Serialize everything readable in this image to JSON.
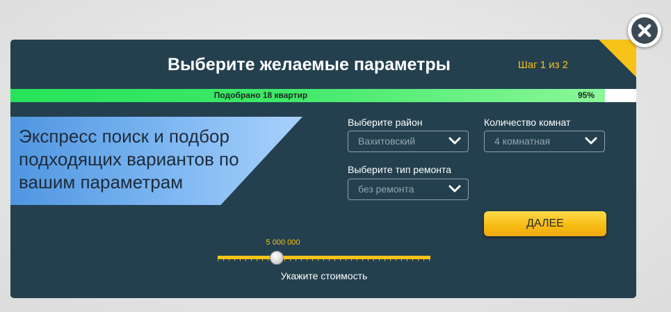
{
  "header": {
    "title": "Выберите желаемые параметры",
    "step": "Шаг 1 из 2"
  },
  "progress": {
    "text": "Подобрано 18 квартир",
    "percent_label": "95%",
    "value_percent": 95
  },
  "banner": {
    "text": "Экспресс поиск и подбор подходящих вариантов по вашим параметрам"
  },
  "filters": {
    "district_label": "Выберите район",
    "district_value": "Вахитовский",
    "rooms_label": "Количество комнат",
    "rooms_value": "4 комнатная",
    "repair_label": "Выберите тип ремонта",
    "repair_value": "без ремонта"
  },
  "next_button": {
    "label": "ДАЛЕЕ"
  },
  "price_slider": {
    "value_label": "5 000 000",
    "caption": "Укажите стоимость"
  },
  "icons": {
    "close": "close-icon",
    "chevron": "chevron-down-icon"
  },
  "colors": {
    "accent_yellow": "#f7c318",
    "modal_bg": "#24404f",
    "progress_green": "#27e35a"
  }
}
